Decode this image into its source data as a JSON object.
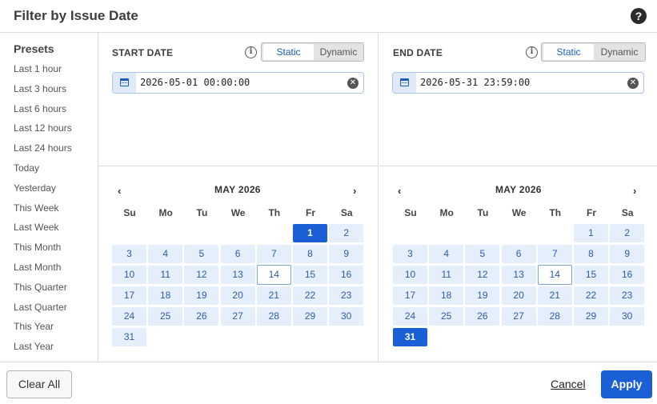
{
  "dialog": {
    "title": "Filter by Issue Date",
    "help_icon": "?"
  },
  "presets": {
    "title": "Presets",
    "items": [
      "Last 1 hour",
      "Last 3 hours",
      "Last 6 hours",
      "Last 12 hours",
      "Last 24 hours",
      "Today",
      "Yesterday",
      "This Week",
      "Last Week",
      "This Month",
      "Last Month",
      "This Quarter",
      "Last Quarter",
      "This Year",
      "Last Year"
    ]
  },
  "start": {
    "label": "START DATE",
    "mode_static": "Static",
    "mode_dynamic": "Dynamic",
    "value": "2026-05-01 00:00:00",
    "calendar": {
      "month": "MAY 2026",
      "prev": "‹",
      "next": "›",
      "weekdays": [
        "Su",
        "Mo",
        "Tu",
        "We",
        "Th",
        "Fr",
        "Sa"
      ],
      "first_weekday": 5,
      "days_in_month": 31,
      "selected_day": 1,
      "today_day": 14
    }
  },
  "end": {
    "label": "END DATE",
    "mode_static": "Static",
    "mode_dynamic": "Dynamic",
    "value": "2026-05-31 23:59:00",
    "calendar": {
      "month": "MAY 2026",
      "prev": "‹",
      "next": "›",
      "weekdays": [
        "Su",
        "Mo",
        "Tu",
        "We",
        "Th",
        "Fr",
        "Sa"
      ],
      "first_weekday": 5,
      "days_in_month": 31,
      "selected_day": 31,
      "today_day": 14
    }
  },
  "footer": {
    "clear_all": "Clear All",
    "cancel": "Cancel",
    "apply": "Apply"
  },
  "colors": {
    "accent": "#1a5fd6",
    "day_bg": "#e5eefb",
    "day_text": "#2c5da6"
  },
  "icons": {
    "help": "question-circle-icon",
    "info": "info-circle-icon",
    "calendar": "calendar-icon",
    "clear": "clear-x-icon"
  }
}
